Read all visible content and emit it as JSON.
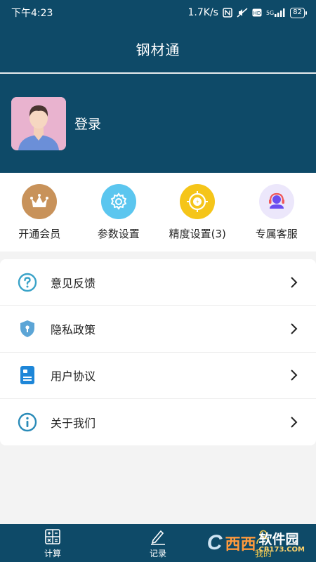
{
  "status_bar": {
    "time": "下午4:23",
    "network_speed": "1.7K/s",
    "signal_label": "5G",
    "battery": "82"
  },
  "header": {
    "title": "钢材通"
  },
  "profile": {
    "login_label": "登录"
  },
  "quick_actions": [
    {
      "label": "开通会员",
      "icon": "crown-icon",
      "color": "#c8925a"
    },
    {
      "label": "参数设置",
      "icon": "gear-icon",
      "color": "#5bc6ef"
    },
    {
      "label": "精度设置(3)",
      "icon": "target-icon",
      "color": "#f5c519"
    },
    {
      "label": "专属客服",
      "icon": "headset-icon",
      "color": "#ece7fb"
    }
  ],
  "menu": [
    {
      "label": "意见反馈",
      "icon": "question-icon"
    },
    {
      "label": "隐私政策",
      "icon": "shield-icon"
    },
    {
      "label": "用户协议",
      "icon": "document-icon"
    },
    {
      "label": "关于我们",
      "icon": "info-icon"
    }
  ],
  "tabs": [
    {
      "label": "计算",
      "icon": "calculator-icon"
    },
    {
      "label": "记录",
      "icon": "pencil-icon"
    },
    {
      "label": "我的",
      "icon": "profile-icon",
      "active": true
    }
  ],
  "watermark": {
    "brand": "西西",
    "text": "软件园",
    "site": "CR173.COM"
  },
  "colors": {
    "primary": "#0e4a68",
    "page_bg": "#f3f3f3",
    "active_tab": "#f2c94c"
  }
}
